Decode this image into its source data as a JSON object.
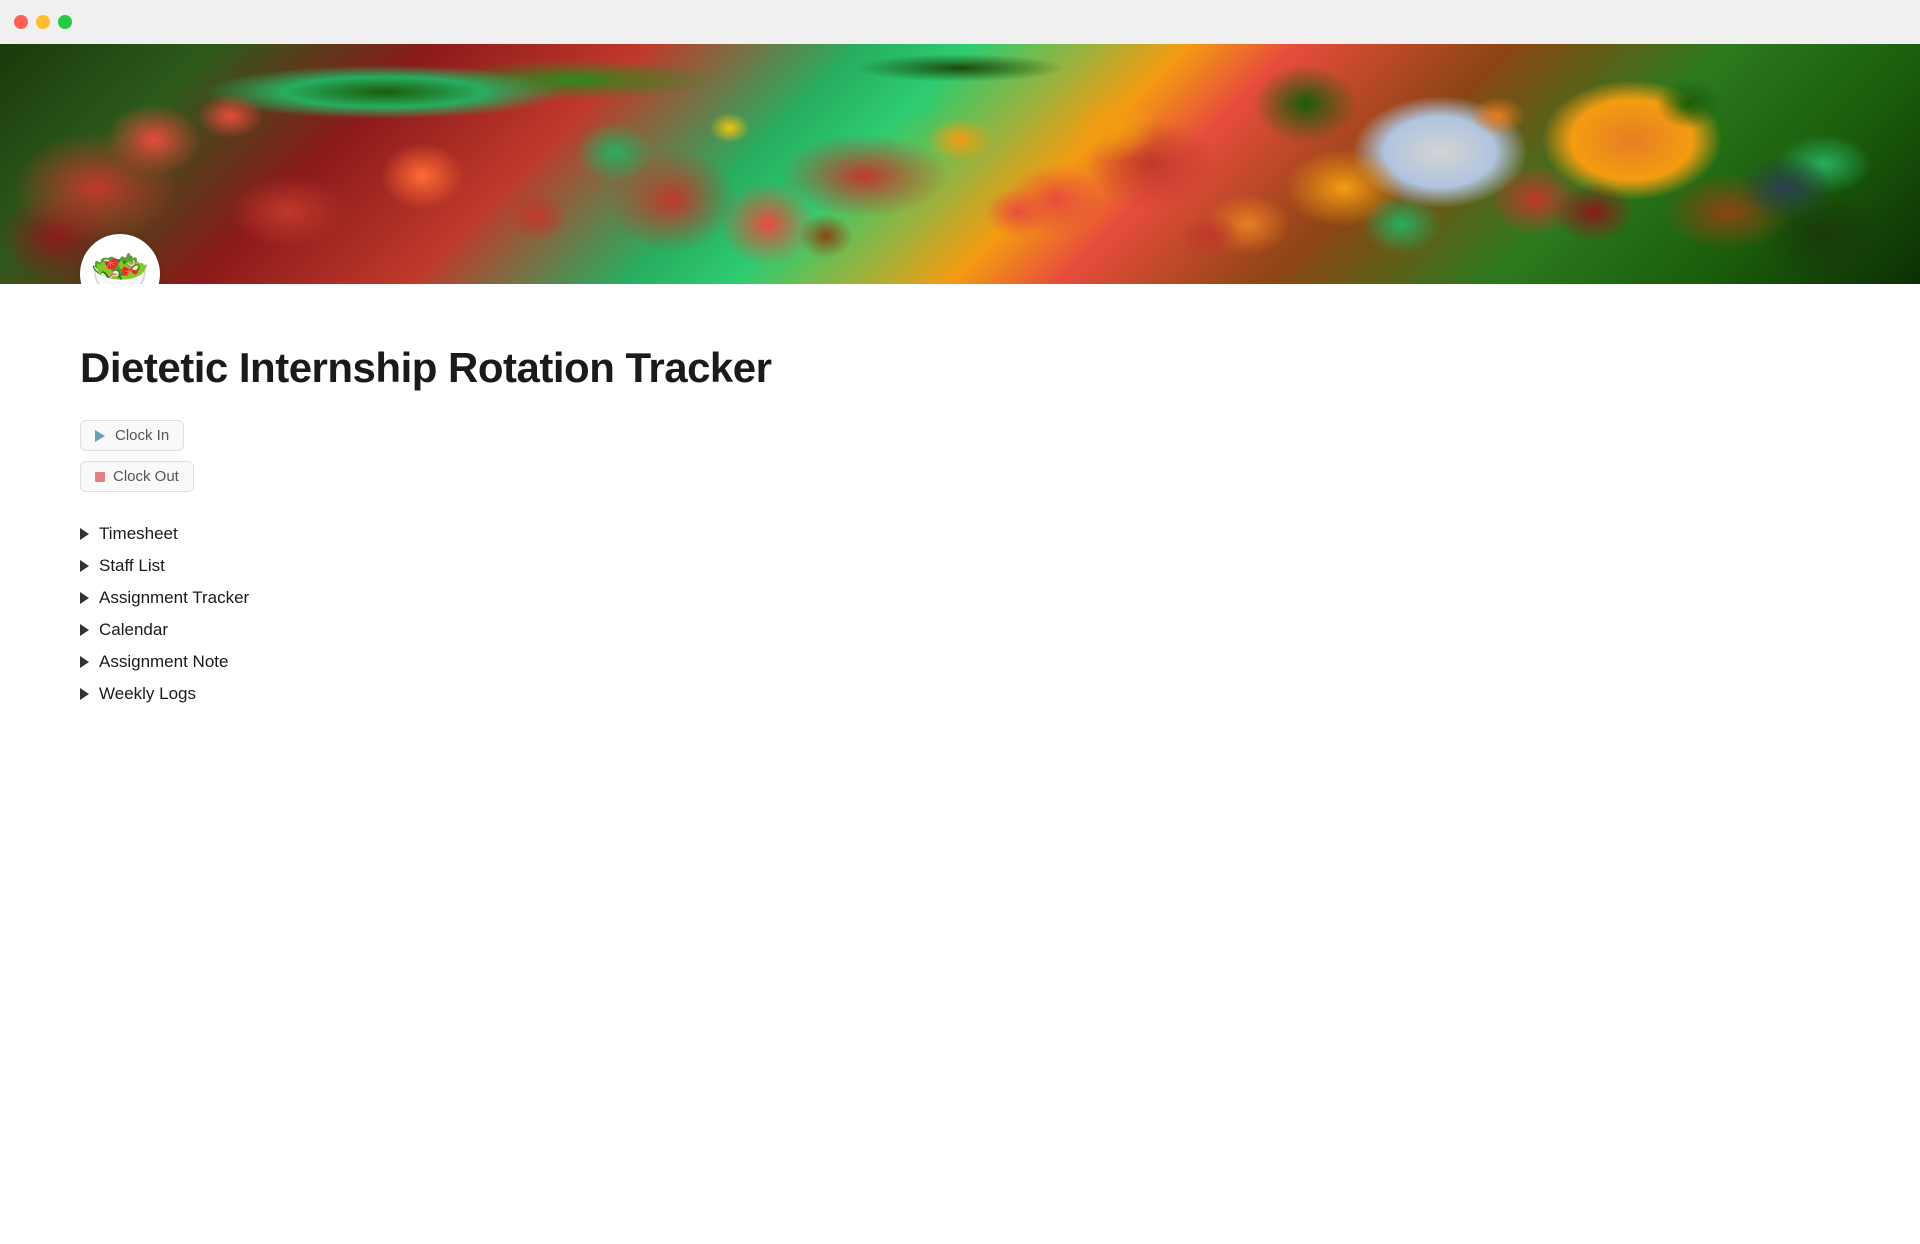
{
  "titleBar": {
    "trafficLights": {
      "close": "close",
      "minimize": "minimize",
      "maximize": "maximize"
    }
  },
  "hero": {
    "iconEmoji": "🥗"
  },
  "page": {
    "title": "Dietetic Internship Rotation Tracker"
  },
  "buttons": [
    {
      "id": "clock-in",
      "label": "Clock In",
      "type": "play"
    },
    {
      "id": "clock-out",
      "label": "Clock Out",
      "type": "stop"
    }
  ],
  "navItems": [
    {
      "id": "timesheet",
      "label": "Timesheet"
    },
    {
      "id": "staff-list",
      "label": "Staff List"
    },
    {
      "id": "assignment-tracker",
      "label": "Assignment Tracker"
    },
    {
      "id": "calendar",
      "label": "Calendar"
    },
    {
      "id": "assignment-note",
      "label": "Assignment Note"
    },
    {
      "id": "weekly-logs",
      "label": "Weekly Logs"
    }
  ]
}
